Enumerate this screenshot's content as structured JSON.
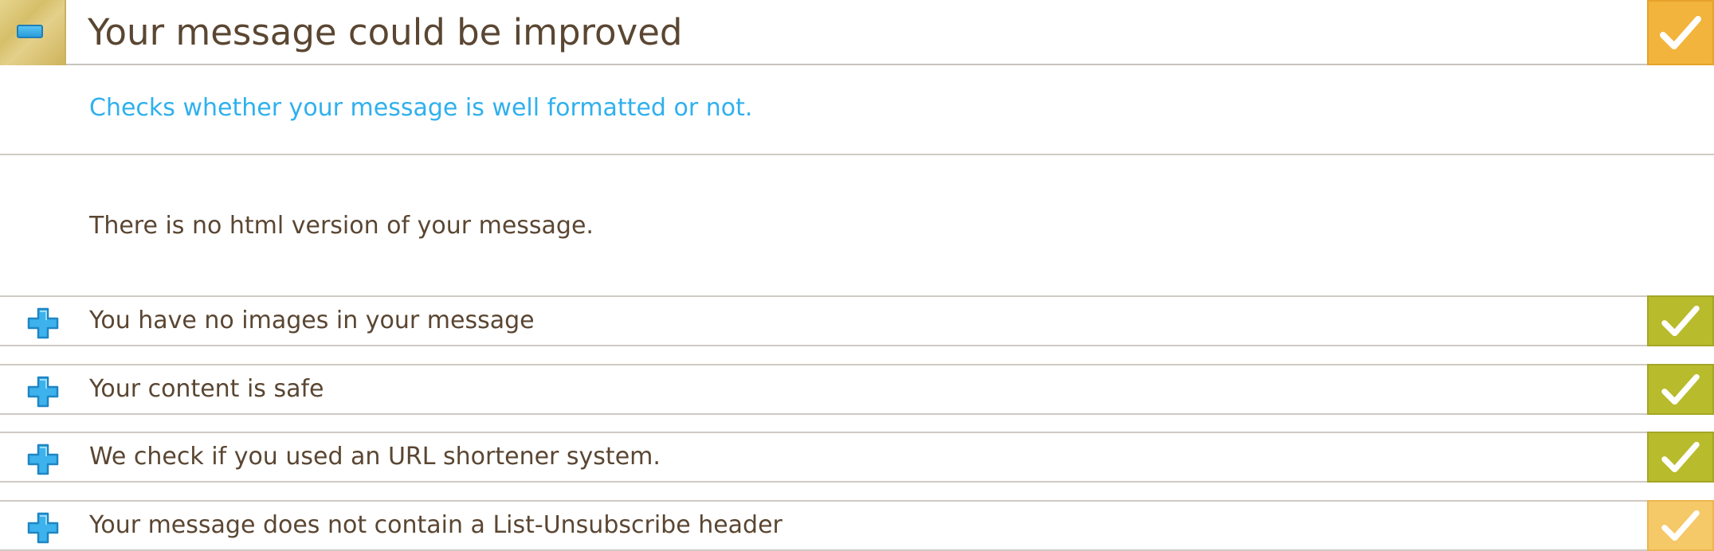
{
  "header": {
    "title": "Your message could be improved",
    "collapse_icon": "minus-icon",
    "status": "warning",
    "status_icon": "check-icon"
  },
  "description": "Checks whether your message is well formatted or not.",
  "message": "There is no html version of your message.",
  "checks": [
    {
      "label": "You have no images in your message",
      "status": "pass",
      "expand_icon": "plus-icon",
      "status_icon": "check-icon"
    },
    {
      "label": "Your content is safe",
      "status": "pass",
      "expand_icon": "plus-icon",
      "status_icon": "check-icon"
    },
    {
      "label": "We check if you used an URL shortener system.",
      "status": "pass",
      "expand_icon": "plus-icon",
      "status_icon": "check-icon"
    },
    {
      "label": "Your message does not contain a List-Unsubscribe header",
      "status": "warning",
      "expand_icon": "plus-icon",
      "status_icon": "check-icon"
    }
  ],
  "colors": {
    "title_text": "#5a4632",
    "description_text": "#2fb0ee",
    "pass": "#b8bb2c",
    "warning": "#f2b43c",
    "warning_light": "#f5c868",
    "icon_blue": "#2fa8e6"
  }
}
